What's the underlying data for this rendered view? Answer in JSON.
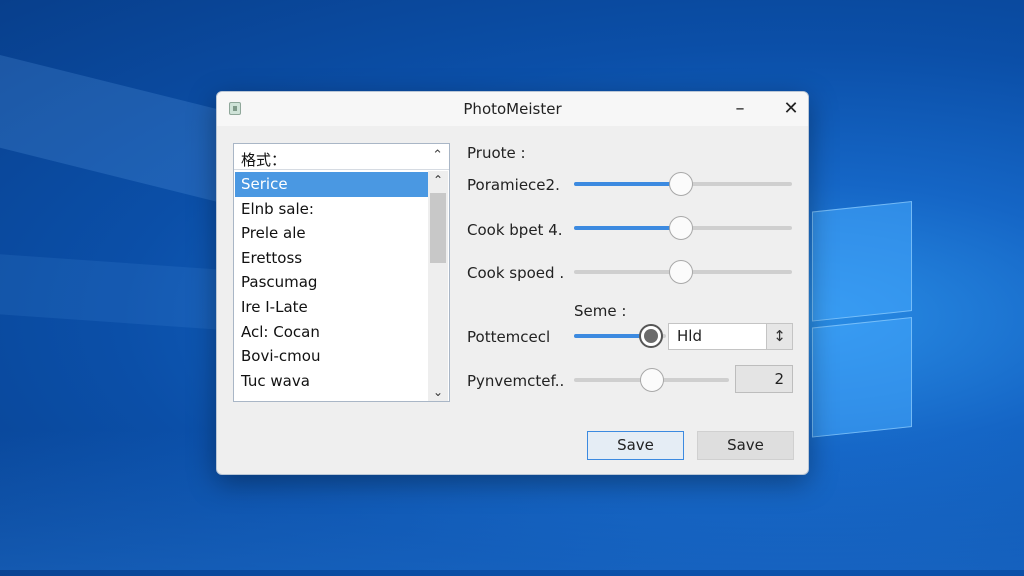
{
  "window": {
    "title": "PhotoMeister",
    "minimize_glyph": "–",
    "close_glyph": "✕"
  },
  "format_list": {
    "header": "格式：",
    "items": [
      "Serice",
      "Elnb sale:",
      "Prele ale",
      "Erettoss",
      "Pascumag",
      "Ire I-Late",
      "Acl: Cocan",
      "Bovi-cmou",
      "Tuc wava"
    ],
    "selected_index": 0,
    "chevron_up": "⌃",
    "chevron_down": "⌄"
  },
  "settings": {
    "section_label": "Pruote :",
    "sliders": [
      {
        "label": "Poramiece2.",
        "value": 0.49
      },
      {
        "label": "Cook bpet 4.",
        "value": 0.49
      },
      {
        "label": "Cook spoed .",
        "value": 0.49
      }
    ],
    "sub_label": "Seme :",
    "combo": {
      "label": "Pottemcecl",
      "value": 0.84,
      "field_value": "Hld",
      "spin_glyph": "↕"
    },
    "number_row": {
      "label": "Pynvemctef..",
      "value": 0.5,
      "number": "2"
    }
  },
  "buttons": {
    "primary": "Save",
    "secondary": "Save"
  },
  "colors": {
    "accent": "#3c8ae0",
    "selection": "#4a98e2",
    "desktop": "#1566c6"
  }
}
